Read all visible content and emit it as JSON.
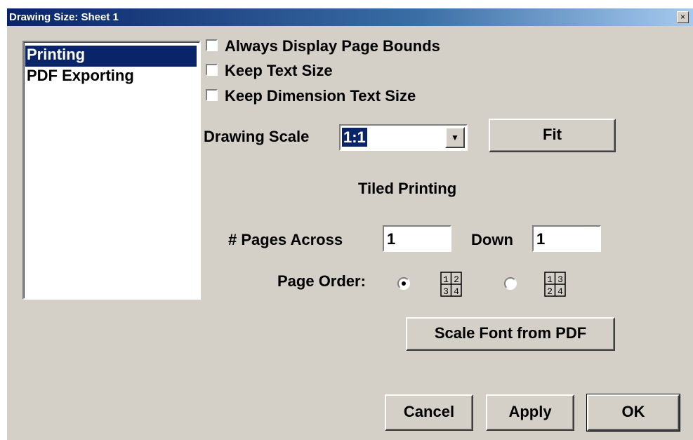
{
  "window": {
    "title": "Drawing Size: Sheet 1",
    "close_glyph": "×"
  },
  "sidebar": {
    "items": [
      {
        "label": "Printing",
        "selected": true
      },
      {
        "label": "PDF Exporting",
        "selected": false
      }
    ]
  },
  "options": {
    "always_display_page_bounds": {
      "label": "Always Display Page Bounds",
      "checked": false
    },
    "keep_text_size": {
      "label": "Keep Text Size",
      "checked": false
    },
    "keep_dimension_text_size": {
      "label": "Keep Dimension Text Size",
      "checked": false
    }
  },
  "scale": {
    "label": "Drawing Scale",
    "value": "1:1",
    "fit_label": "Fit"
  },
  "tiled": {
    "heading": "Tiled Printing",
    "pages_across_label": "# Pages Across",
    "pages_across_value": "1",
    "down_label": "Down",
    "down_value": "1",
    "page_order_label": "Page Order:",
    "order_row_major": {
      "selected": true,
      "icon": "page-order-row-major-icon",
      "cells": [
        "1",
        "2",
        "3",
        "4"
      ]
    },
    "order_column_major": {
      "selected": false,
      "icon": "page-order-column-major-icon",
      "cells": [
        "1",
        "3",
        "2",
        "4"
      ]
    }
  },
  "scale_font_button": "Scale Font from PDF",
  "footer": {
    "cancel": "Cancel",
    "apply": "Apply",
    "ok": "OK"
  }
}
